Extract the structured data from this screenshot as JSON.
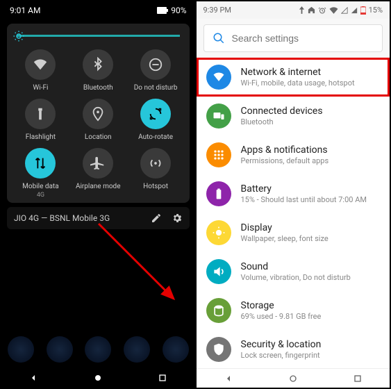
{
  "left": {
    "status": {
      "time": "9:01 AM",
      "battery": "90%"
    },
    "tiles": [
      {
        "label": "Wi-Fi",
        "sub": "",
        "icon": "wifi",
        "on": false
      },
      {
        "label": "Bluetooth",
        "sub": "",
        "icon": "bluetooth",
        "on": false
      },
      {
        "label": "Do not disturb",
        "sub": "",
        "icon": "dnd",
        "on": false
      },
      {
        "label": "Flashlight",
        "sub": "",
        "icon": "flashlight",
        "on": false
      },
      {
        "label": "Location",
        "sub": "",
        "icon": "location",
        "on": false
      },
      {
        "label": "Auto-rotate",
        "sub": "",
        "icon": "rotate",
        "on": true
      },
      {
        "label": "Mobile data",
        "sub": "4G",
        "icon": "data",
        "on": true
      },
      {
        "label": "Airplane mode",
        "sub": "",
        "icon": "airplane",
        "on": false
      },
      {
        "label": "Hotspot",
        "sub": "",
        "icon": "hotspot",
        "on": false
      }
    ],
    "footer": {
      "carrier": "JIO 4G — BSNL Mobile 3G"
    }
  },
  "right": {
    "status": {
      "time": "9:39 PM",
      "battery": "15%"
    },
    "search": {
      "placeholder": "Search settings"
    },
    "items": [
      {
        "title": "Network & internet",
        "sub": "Wi-Fi, mobile, data usage, hotspot",
        "color": "#1e88e5",
        "icon": "wifi",
        "hl": true
      },
      {
        "title": "Connected devices",
        "sub": "Bluetooth",
        "color": "#43a047",
        "icon": "devices"
      },
      {
        "title": "Apps & notifications",
        "sub": "Permissions, default apps",
        "color": "#fb8c00",
        "icon": "apps"
      },
      {
        "title": "Battery",
        "sub": "15% - Should last until about 7:00 AM",
        "color": "#8e24aa",
        "icon": "battery"
      },
      {
        "title": "Display",
        "sub": "Wallpaper, sleep, font size",
        "color": "#fdd835",
        "icon": "display"
      },
      {
        "title": "Sound",
        "sub": "Volume, vibration, Do not disturb",
        "color": "#00acc1",
        "icon": "sound"
      },
      {
        "title": "Storage",
        "sub": "69% used - 9.81 GB free",
        "color": "#689f38",
        "icon": "storage"
      },
      {
        "title": "Security & location",
        "sub": "Lock screen, fingerprint",
        "color": "#757575",
        "icon": "security"
      }
    ]
  }
}
